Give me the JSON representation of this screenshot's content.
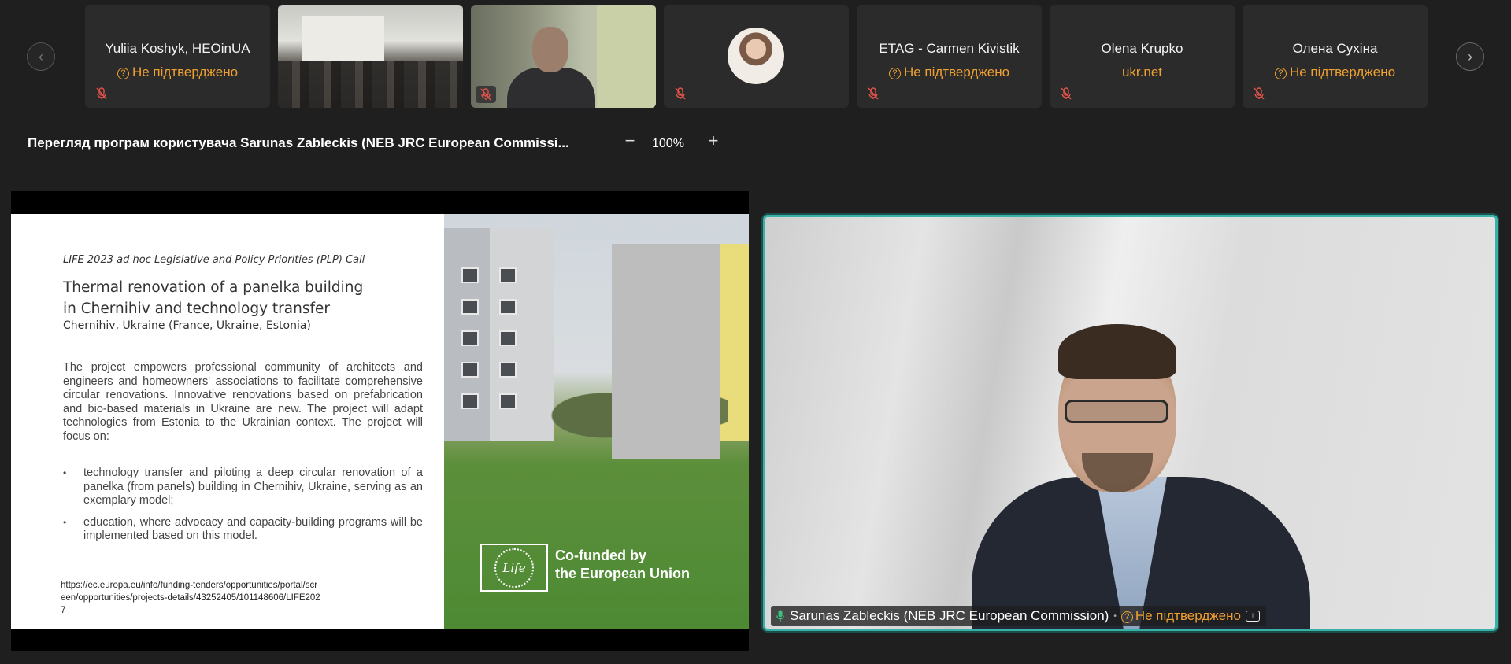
{
  "gallery": {
    "participants": [
      {
        "name": "Yuliia Koshyk, HEOinUA",
        "status": "Не підтверджено"
      },
      {
        "name": "",
        "status": ""
      },
      {
        "name": "",
        "status": ""
      },
      {
        "name": "",
        "status": ""
      },
      {
        "name": "ETAG - Carmen Kivistik",
        "status": "Не підтверджено"
      },
      {
        "name": "Olena Krupko",
        "status": "ukr.net"
      },
      {
        "name": "Олена Сухіна",
        "status": "Не підтверджено"
      }
    ]
  },
  "share": {
    "title": "Перегляд програм користувача Sarunas Zableckis (NEB JRC European Commissi...",
    "zoom": "100%"
  },
  "slide": {
    "call": "LIFE 2023 ad hoc Legislative and Policy Priorities (PLP) Call",
    "title_line1": "Thermal renovation of a panelka building",
    "title_line2": "in Chernihiv and technology transfer",
    "subtitle": "Chernihiv, Ukraine (France, Ukraine, Estonia)",
    "body": "The project empowers professional community of architects and engineers and homeowners' associations to facilitate comprehensive circular renovations. Innovative renovations based on prefabrication and bio-based materials in Ukraine are new. The project will adapt technologies from Estonia to the Ukrainian context. The project will focus on:",
    "bullets": [
      "technology transfer and piloting a deep circular renovation of a panelka (from panels) building in Chernihiv, Ukraine, serving as an exemplary model;",
      "education, where advocacy and capacity-building programs will be implemented based on this model."
    ],
    "link": "https://ec.europa.eu/info/funding-tenders/opportunities/portal/screen/opportunities/projects-details/43252405/101148606/LIFE2027",
    "logo_text": "Life",
    "cofunded_line1": "Co-funded by",
    "cofunded_line2": "the European Union"
  },
  "speaker": {
    "name": "Sarunas Zableckis (NEB JRC European Commission)",
    "separator": "•",
    "status": "Не підтверджено"
  },
  "colors": {
    "accent": "#38b2a8",
    "warning": "#f0a030",
    "background": "#1f1f1f",
    "tile": "#2b2b2b"
  },
  "icons": {
    "prev": "chevron-left-icon",
    "next": "chevron-right-icon",
    "mute": "mic-off-icon",
    "status": "question-circle-icon",
    "speaker_mic": "mic-icon",
    "share": "screen-share-icon"
  }
}
